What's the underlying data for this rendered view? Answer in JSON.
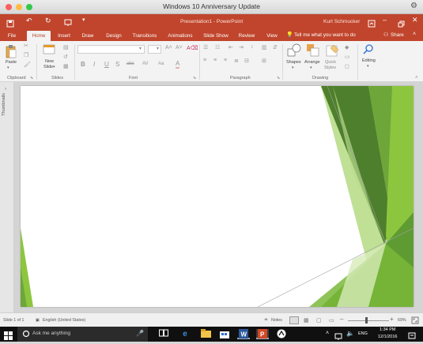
{
  "mac": {
    "title": "Windows 10 Anniversary Update",
    "colors": {
      "close": "#fc605c",
      "minimize": "#fdbc40",
      "zoom": "#34c84a"
    }
  },
  "ppt": {
    "title": "Presentation1 - PowerPoint",
    "user": "Kurt Schmucker",
    "accent": "#c0452c"
  },
  "tabs": [
    "File",
    "Home",
    "Insert",
    "Draw",
    "Design",
    "Transitions",
    "Animations",
    "Slide Show",
    "Review",
    "View"
  ],
  "tell_me": "Tell me what you want to do",
  "share": "Share",
  "ribbon": {
    "paste": "Paste",
    "new_slide_line1": "New",
    "new_slide_line2": "Slide",
    "shapes": "Shapes",
    "arrange": "Arrange",
    "quick_styles_line1": "Quick",
    "quick_styles_line2": "Styles",
    "editing": "Editing",
    "groups": [
      "Clipboard",
      "Slides",
      "Font",
      "Paragraph",
      "Drawing"
    ],
    "font_buttons": [
      "B",
      "I",
      "U",
      "S",
      "abc",
      "AV",
      "Aa",
      "A"
    ]
  },
  "side_panel": {
    "label": "Thumbnails"
  },
  "status": {
    "slide_count": "Slide 1 of 1",
    "language": "English (United States)",
    "notes": "Notes",
    "zoom": "69%"
  },
  "taskbar": {
    "search_placeholder": "Ask me anything",
    "lang": "ENG",
    "time": "1:34 PM",
    "date": "12/1/2016"
  }
}
